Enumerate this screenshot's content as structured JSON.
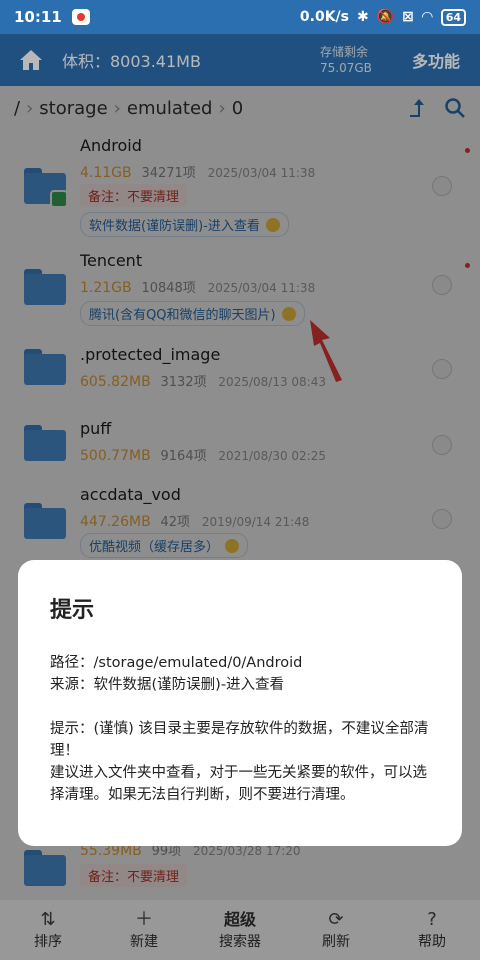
{
  "status": {
    "time": "10:11",
    "net_speed": "0.0K/s",
    "battery": "64"
  },
  "header": {
    "volume_label": "体积：8003.41MB",
    "free_label": "存储剩余",
    "free_value": "75.07GB",
    "multi_label": "多功能"
  },
  "path": {
    "root": "/",
    "seg1": "storage",
    "seg2": "emulated",
    "seg3": "0"
  },
  "files": [
    {
      "name": "Android",
      "size": "4.11GB",
      "count": "34271项",
      "date": "2025/03/04 11:38",
      "note": "备注：不要清理",
      "tag": "软件数据(谨防误删)-进入查看"
    },
    {
      "name": "Tencent",
      "size": "1.21GB",
      "count": "10848项",
      "date": "2025/03/04 11:38",
      "tag": "腾讯(含有QQ和微信的聊天图片)"
    },
    {
      "name": ".protected_image",
      "size": "605.82MB",
      "count": "3132项",
      "date": "2025/08/13 08:43"
    },
    {
      "name": "puff",
      "size": "500.77MB",
      "count": "9164项",
      "date": "2021/08/30 02:25"
    },
    {
      "name": "accdata_vod",
      "size": "447.26MB",
      "count": "42项",
      "date": "2019/09/14 21:48",
      "tag": "优酷视频（缓存居多）"
    },
    {
      "name": "",
      "size": "55.39MB",
      "count": "99项",
      "date": "2025/03/28 17:20",
      "note": "备注：不要清理"
    }
  ],
  "dialog": {
    "title": "提示",
    "path_line": "路径：/storage/emulated/0/Android",
    "source_line": "来源：软件数据(谨防误删)-进入查看",
    "tip_line1": "提示：(谨慎) 该目录主要是存放软件的数据，不建议全部清理！",
    "tip_line2": "建议进入文件夹中查看，对于一些无关紧要的软件，可以选择清理。如果无法自行判断，则不要进行清理。"
  },
  "bottom_nav": {
    "sort": "排序",
    "new": "新建",
    "super_top": "超级",
    "super_bottom": "搜索器",
    "refresh": "刷新",
    "help": "帮助"
  },
  "colors": {
    "primary": "#2c6fb0",
    "size_orange": "#e6a23c",
    "note_red": "#c0392b"
  }
}
